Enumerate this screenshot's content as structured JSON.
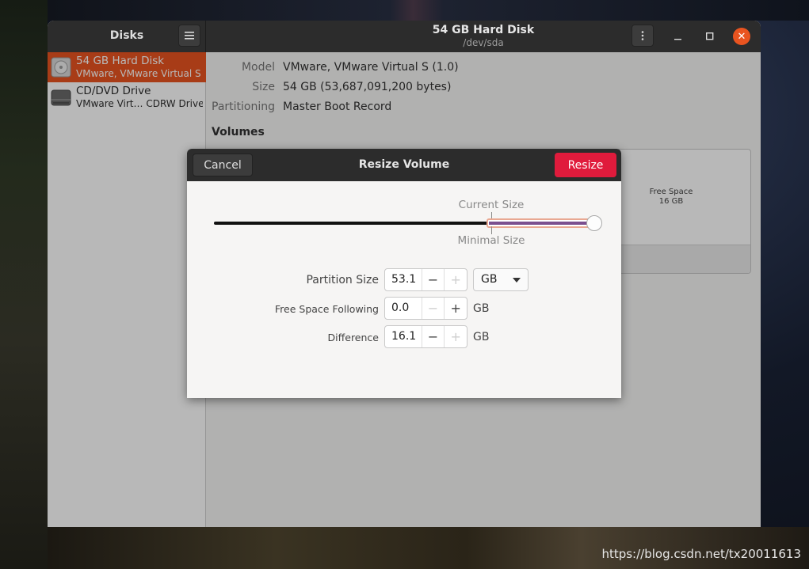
{
  "window": {
    "app_title": "Disks",
    "title": "54 GB Hard Disk",
    "subtitle": "/dev/sda",
    "controls": {
      "menu_icon": "kebab-menu-icon",
      "close": "✕"
    }
  },
  "sidebar": {
    "items": [
      {
        "name": "54 GB Hard Disk",
        "sub": "VMware, VMware Virtual S",
        "icon": "hard-disk-icon",
        "selected": true
      },
      {
        "name": "CD/DVD Drive",
        "sub": "VMware Virt… CDRW Drive",
        "icon": "optical-drive-icon",
        "selected": false
      }
    ]
  },
  "details": {
    "model_label": "Model",
    "model_value": "VMware, VMware Virtual S (1.0)",
    "size_label": "Size",
    "size_value": "54 GB (53,687,091,200 bytes)",
    "partitioning_label": "Partitioning",
    "partitioning_value": "Master Boot Record",
    "volumes_heading": "Volumes",
    "free_space_name": "Free Space",
    "free_space_size": "16 GB"
  },
  "dialog": {
    "title": "Resize Volume",
    "cancel_label": "Cancel",
    "resize_label": "Resize",
    "slider": {
      "current_size_label": "Current Size",
      "minimal_size_label": "Minimal Size",
      "value_fraction": 1.0,
      "current_fraction": 0.725,
      "minimal_fraction": 0.725
    },
    "partition_size": {
      "label": "Partition Size",
      "value": "53.1",
      "unit": "GB",
      "decrement_enabled": true,
      "increment_enabled": false
    },
    "free_space_following": {
      "label": "Free Space Following",
      "value": "0.0",
      "unit": "GB",
      "decrement_enabled": false,
      "increment_enabled": true
    },
    "difference": {
      "label": "Difference",
      "value": "16.1",
      "unit": "GB",
      "decrement_enabled": true,
      "increment_enabled": false
    }
  },
  "watermark": "https://blog.csdn.net/tx20011613",
  "colors": {
    "accent": "#e95420",
    "destructive": "#e01b3c",
    "headerbar": "#2c2c2c"
  }
}
